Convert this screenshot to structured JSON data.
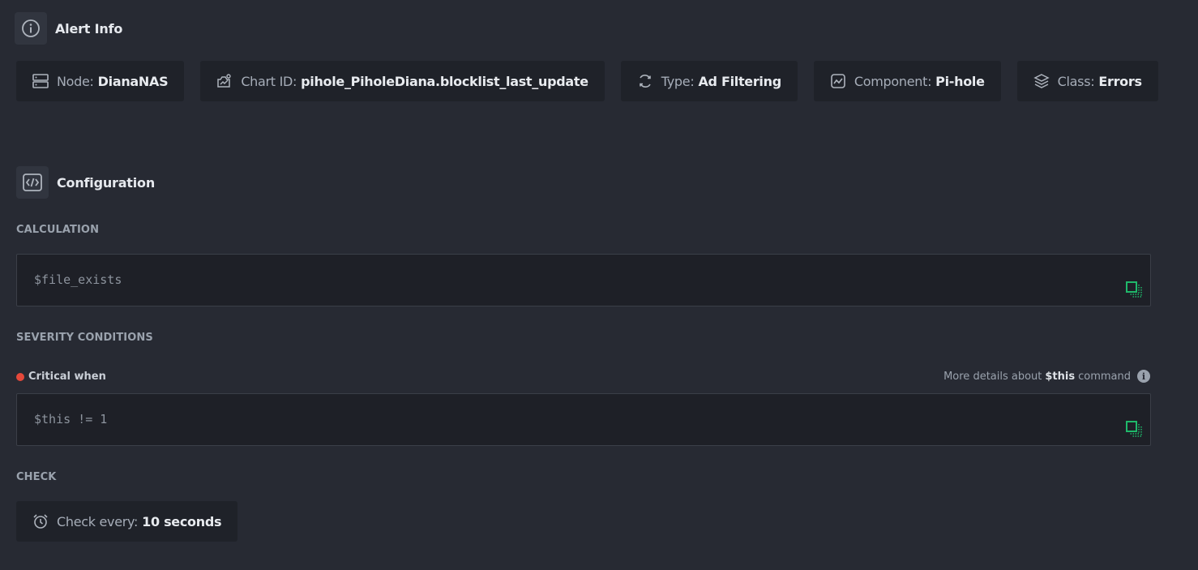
{
  "alert_info": {
    "title": "Alert Info",
    "chips": [
      {
        "icon": "server-icon",
        "label": "Node:",
        "value": "DianaNAS"
      },
      {
        "icon": "chart-id-icon",
        "label": "Chart ID:",
        "value": "pihole_PiholeDiana.blocklist_last_update"
      },
      {
        "icon": "refresh-icon",
        "label": "Type:",
        "value": "Ad Filtering"
      },
      {
        "icon": "component-icon",
        "label": "Component:",
        "value": "Pi-hole"
      },
      {
        "icon": "layers-icon",
        "label": "Class:",
        "value": "Errors"
      }
    ]
  },
  "configuration": {
    "title": "Configuration",
    "calculation_label": "CALCULATION",
    "calculation_value": "$file_exists",
    "severity_label": "SEVERITY CONDITIONS",
    "critical_label": "Critical when",
    "critical_color": "#e5483a",
    "more_details_prefix": "More details about",
    "more_details_keyword": "$this",
    "more_details_suffix": "command",
    "critical_value": "$this != 1",
    "check_label": "CHECK",
    "check_every_label": "Check every:",
    "check_every_value": "10 seconds"
  },
  "colors": {
    "background": "#272a33",
    "chip_background": "#1f2229",
    "copy_icon": "#1fb86a"
  }
}
